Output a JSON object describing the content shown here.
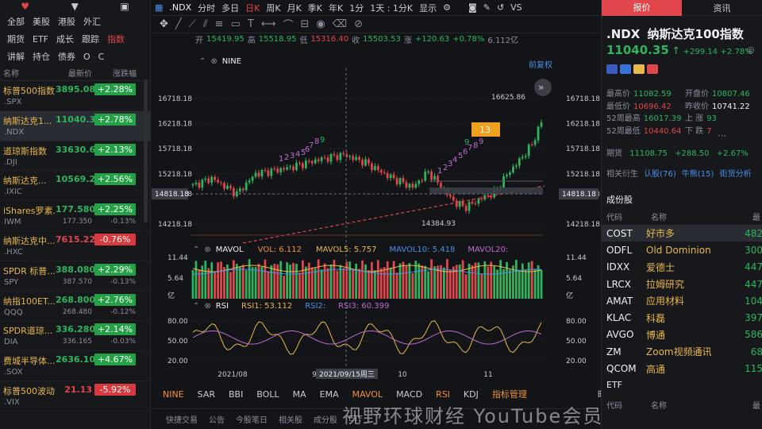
{
  "left": {
    "top_icons": [
      "heart-icon",
      "filter-icon",
      "wallet-icon"
    ],
    "tabs_row1": [
      "全部",
      "美股",
      "港股",
      "外汇"
    ],
    "tabs_row2": [
      "期货",
      "ETF",
      "成长",
      "跟踪",
      "指数"
    ],
    "tabs_row3": [
      "讲解",
      "持仓",
      "债券",
      "O",
      "C"
    ],
    "active_tab": "指数",
    "headers": [
      "名称",
      "最新价",
      "涨跌幅"
    ],
    "rows": [
      {
        "name": "标普500指数",
        "sym": ".SPX",
        "price": "3895.08",
        "sub": "",
        "chg": "+2.28%",
        "sub2": "",
        "dir": "up"
      },
      {
        "name": "纳斯达克1...",
        "sym": ".NDX",
        "price": "11040.35",
        "sub": "",
        "chg": "+2.78%",
        "sub2": "",
        "dir": "up",
        "sel": true
      },
      {
        "name": "道琼斯指数",
        "sym": ".DJI",
        "price": "33630.61",
        "sub": "",
        "chg": "+2.13%",
        "sub2": "",
        "dir": "up"
      },
      {
        "name": "纳斯达克...",
        "sym": ".IXIC",
        "price": "10569.29",
        "sub": "",
        "chg": "+2.56%",
        "sub2": "",
        "dir": "up"
      },
      {
        "name": "iShares罗素...",
        "sym": "IWM",
        "price": "177.580",
        "sub": "177.350",
        "chg": "+2.25%",
        "sub2": "-0.13%",
        "dir": "up"
      },
      {
        "name": "纳斯达克中...",
        "sym": ".HXC",
        "price": "7615.22",
        "sub": "",
        "chg": "-0.76%",
        "sub2": "",
        "dir": "dn"
      },
      {
        "name": "SPDR 标普...",
        "sym": "SPY",
        "price": "388.080",
        "sub": "387.570",
        "chg": "+2.29%",
        "sub2": "-0.13%",
        "dir": "up"
      },
      {
        "name": "纳指100ET...",
        "sym": "QQQ",
        "price": "268.800",
        "sub": "268.480",
        "chg": "+2.76%",
        "sub2": "-0.12%",
        "dir": "up"
      },
      {
        "name": "SPDR道琼...",
        "sym": "DIA",
        "price": "336.280",
        "sub": "336.165",
        "chg": "+2.14%",
        "sub2": "-0.03%",
        "dir": "up"
      },
      {
        "name": "费城半导体...",
        "sym": ".SOX",
        "price": "2636.10",
        "sub": "",
        "chg": "+4.67%",
        "sub2": "",
        "dir": "up"
      },
      {
        "name": "标普500波动...",
        "sym": ".VIX",
        "price": "21.13",
        "sub": "",
        "chg": "-5.92%",
        "sub2": "",
        "dir": "dn"
      }
    ]
  },
  "mid": {
    "symbol": ".NDX",
    "periods": [
      "分时",
      "多日",
      "日K",
      "周K",
      "月K",
      "季K",
      "年K",
      "1分",
      "1天 : 1分K",
      "显示"
    ],
    "active_period": "日K",
    "vs": "VS",
    "quote": {
      "open_l": "开",
      "open": "15419.95",
      "high_l": "高",
      "high": "15518.95",
      "low_l": "低",
      "low": "15316.40",
      "close_l": "收",
      "close": "15503.53",
      "chg_l": "涨",
      "chg": "+120.63",
      "pct": "+0.78%",
      "amp": "6.112亿"
    },
    "nine_label": "NINE",
    "fq_label": "前复权",
    "price_ticks": [
      "16718.18",
      "16218.18",
      "15718.18",
      "15218.18",
      "14818.18",
      "14218.18"
    ],
    "crosshair_price": "14818.18",
    "hi_label": "16625.86",
    "lo_label": "14384.93",
    "box_label": "13",
    "seq_nums": [
      "1",
      "2",
      "3",
      "4",
      "5",
      "6",
      "7",
      "8",
      "9",
      "1",
      "2",
      "3",
      "4",
      "5",
      "6",
      "7",
      "8",
      "9",
      "9"
    ],
    "mavol": {
      "name": "MAVOL",
      "vol": "VOL: 6.112",
      "m5": "MAVOL5: 5.757",
      "m10": "MAVOL10: 5.418",
      "m20": "MAVOL20:"
    },
    "vol_ticks": [
      "11.44",
      "5.64",
      "亿"
    ],
    "rsi": {
      "name": "RSI",
      "r1": "RSI1: 53.112",
      "r2": "RSI2:",
      "r3": "RSI3: 60.399"
    },
    "rsi_ticks": [
      "80.00",
      "50.00",
      "20.00"
    ],
    "x_labels": [
      "2021/08",
      "9",
      "10",
      "11"
    ],
    "cross_date": "2021/09/15周三",
    "btabs": [
      "NINE",
      "SAR",
      "BBI",
      "BOLL",
      "MA",
      "EMA",
      "MAVOL",
      "MACD",
      "RSI",
      "KDJ",
      "指标管理",
      "时段"
    ],
    "btabs_on": [
      "NINE",
      "MAVOL",
      "RSI",
      "指标管理"
    ],
    "bottom": [
      "快捷交易",
      "公告",
      "今股笔日",
      "相关股",
      "成分股",
      "ETF"
    ],
    "watermark": "视野环球财经 YouTube会员专享"
  },
  "right": {
    "tabs": [
      "报价",
      "资讯"
    ],
    "symbol": ".NDX",
    "name": "纳斯达克100指数",
    "price": "11040.35",
    "chg": "+299.14",
    "pct": "+2.78%",
    "stats": [
      {
        "l": "最高价",
        "v": "11082.59",
        "c": "green"
      },
      {
        "l": "开盘价",
        "v": "10807.46",
        "c": "green"
      },
      {
        "l": "最低价",
        "v": "10696.42",
        "c": "red"
      },
      {
        "l": "昨收价",
        "v": "10741.22",
        "c": "white"
      },
      {
        "l": "52周最高",
        "v": "16017.39",
        "c": "green"
      },
      {
        "l": "上 涨",
        "v": "93",
        "c": "green"
      },
      {
        "l": "52周最低",
        "v": "10440.64",
        "c": "red"
      },
      {
        "l": "下 跌",
        "v": "7",
        "c": "red"
      }
    ],
    "futures": {
      "l": "期货",
      "v": "11108.75",
      "chg": "+288.50",
      "pct": "+2.67%"
    },
    "related": {
      "l": "相关衍生",
      "a": "认股(76)",
      "b": "牛熊(15)",
      "c": "街货分析"
    },
    "comp_title": "成份股",
    "comp_head": [
      "代码",
      "名称",
      "最"
    ],
    "components": [
      {
        "s": "COST",
        "n": "好市多",
        "v": "482",
        "sel": true
      },
      {
        "s": "ODFL",
        "n": "Old Dominion",
        "v": "300"
      },
      {
        "s": "IDXX",
        "n": "爱德士",
        "v": "447"
      },
      {
        "s": "LRCX",
        "n": "拉姆研究",
        "v": "447"
      },
      {
        "s": "AMAT",
        "n": "应用材料",
        "v": "104"
      },
      {
        "s": "KLAC",
        "n": "科磊",
        "v": "397"
      },
      {
        "s": "AVGO",
        "n": "博通",
        "v": "586"
      },
      {
        "s": "ZM",
        "n": "Zoom视频通讯",
        "v": "68"
      },
      {
        "s": "QCOM",
        "n": "高通",
        "v": "115"
      }
    ],
    "etf_title": "ETF",
    "etf_head": [
      "代码",
      "名称",
      "最"
    ]
  }
}
